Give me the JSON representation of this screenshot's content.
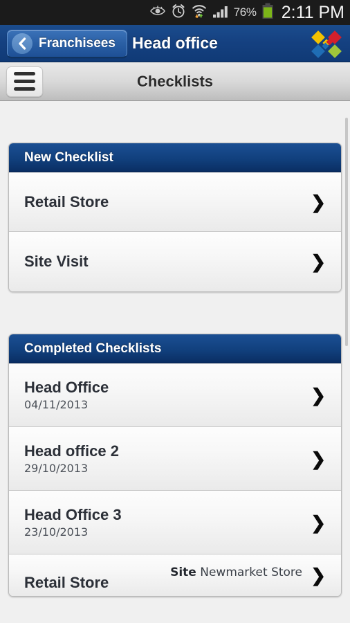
{
  "status_bar": {
    "icons": [
      "eye-icon",
      "alarm-clock-icon",
      "wifi-icon",
      "signal-bars-icon"
    ],
    "battery_percent": "76%",
    "time": "2:11 PM"
  },
  "nav_bar": {
    "back_label": "Franchisees",
    "back_icon": "chevron-left-icon",
    "title": "Head office",
    "logo": "four-diamonds-logo",
    "logo_colors": {
      "top_left": "#f3c200",
      "top_right": "#d4202b",
      "bottom_left": "#1f6db5",
      "bottom_right": "#9fc63b"
    },
    "background": "#154181"
  },
  "sub_bar": {
    "menu_icon": "hamburger-menu-icon",
    "title": "Checklists"
  },
  "sections": [
    {
      "header": "New Checklist",
      "rows": [
        {
          "title": "Retail Store",
          "date": "",
          "meta_label": "",
          "meta_value": "",
          "chevron": "❯"
        },
        {
          "title": "Site Visit",
          "date": "",
          "meta_label": "",
          "meta_value": "",
          "chevron": "❯"
        }
      ]
    },
    {
      "header": "Completed Checklists",
      "rows": [
        {
          "title": "Head Office",
          "date": "04/11/2013",
          "meta_label": "",
          "meta_value": "",
          "chevron": "❯"
        },
        {
          "title": "Head office 2",
          "date": "29/10/2013",
          "meta_label": "",
          "meta_value": "",
          "chevron": "❯"
        },
        {
          "title": "Head Office 3",
          "date": "23/10/2013",
          "meta_label": "",
          "meta_value": "",
          "chevron": "❯"
        },
        {
          "title": "Retail Store",
          "date": "",
          "meta_label": "Site",
          "meta_value": "Newmarket Store",
          "chevron": "❯"
        }
      ]
    }
  ],
  "theme": {
    "header_blue": "#11407d",
    "nav_blue": "#154181",
    "page_bg": "#f0f0f0",
    "row_text": "#2c3038"
  }
}
